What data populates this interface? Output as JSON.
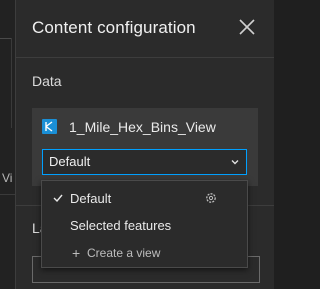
{
  "panel": {
    "title": "Content configuration",
    "data_section_label": "Data",
    "layer": {
      "name": "1_Mile_Hex_Bins_View",
      "icon": "layer-view-icon"
    },
    "view_select": {
      "value": "Default"
    },
    "next_section_label_partial": "La"
  },
  "background": {
    "partial_text": "Vi"
  },
  "dropdown": {
    "items": [
      {
        "label": "Default",
        "selected": true,
        "icon": "gear-icon"
      },
      {
        "label": "Selected features",
        "selected": false
      },
      {
        "label": "Create a view",
        "prefix": "+"
      }
    ]
  },
  "colors": {
    "panel_bg": "#2b2b2b",
    "card_bg": "#3a3a3a",
    "accent": "#00a0ff",
    "text": "#eaeaea"
  }
}
